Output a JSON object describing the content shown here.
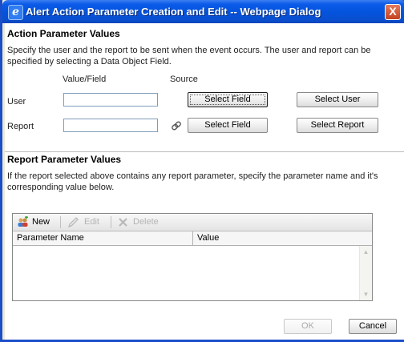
{
  "window": {
    "title": "Alert Action Parameter Creation and Edit -- Webpage Dialog",
    "close_glyph": "X"
  },
  "action_section": {
    "title": "Action Parameter Values",
    "description": "Specify the user and the report to be sent when the event occurs. The user and report can be specified by selecting a Data Object Field.",
    "col_value_field": "Value/Field",
    "col_source": "Source",
    "user": {
      "label": "User",
      "value": "",
      "select_field": "Select Field",
      "select_other": "Select User"
    },
    "report": {
      "label": "Report",
      "value": "",
      "select_field": "Select Field",
      "select_other": "Select Report"
    }
  },
  "report_section": {
    "title": "Report Parameter Values",
    "description": "If the report selected above contains any report parameter, specify the parameter name and it's corresponding value below.",
    "toolbar": {
      "new": "New",
      "edit": "Edit",
      "delete": "Delete"
    },
    "columns": [
      "Parameter Name",
      "Value"
    ],
    "rows": []
  },
  "footer": {
    "ok": "OK",
    "cancel": "Cancel"
  },
  "icons": {
    "title": "ie-icon",
    "report_link": "link-icon",
    "new": "new-users-icon",
    "edit": "pencil-icon",
    "delete": "delete-x-icon"
  },
  "colors": {
    "titlebar": "#0453dd",
    "background": "#ffffff",
    "frame": "#1b4fc8"
  }
}
